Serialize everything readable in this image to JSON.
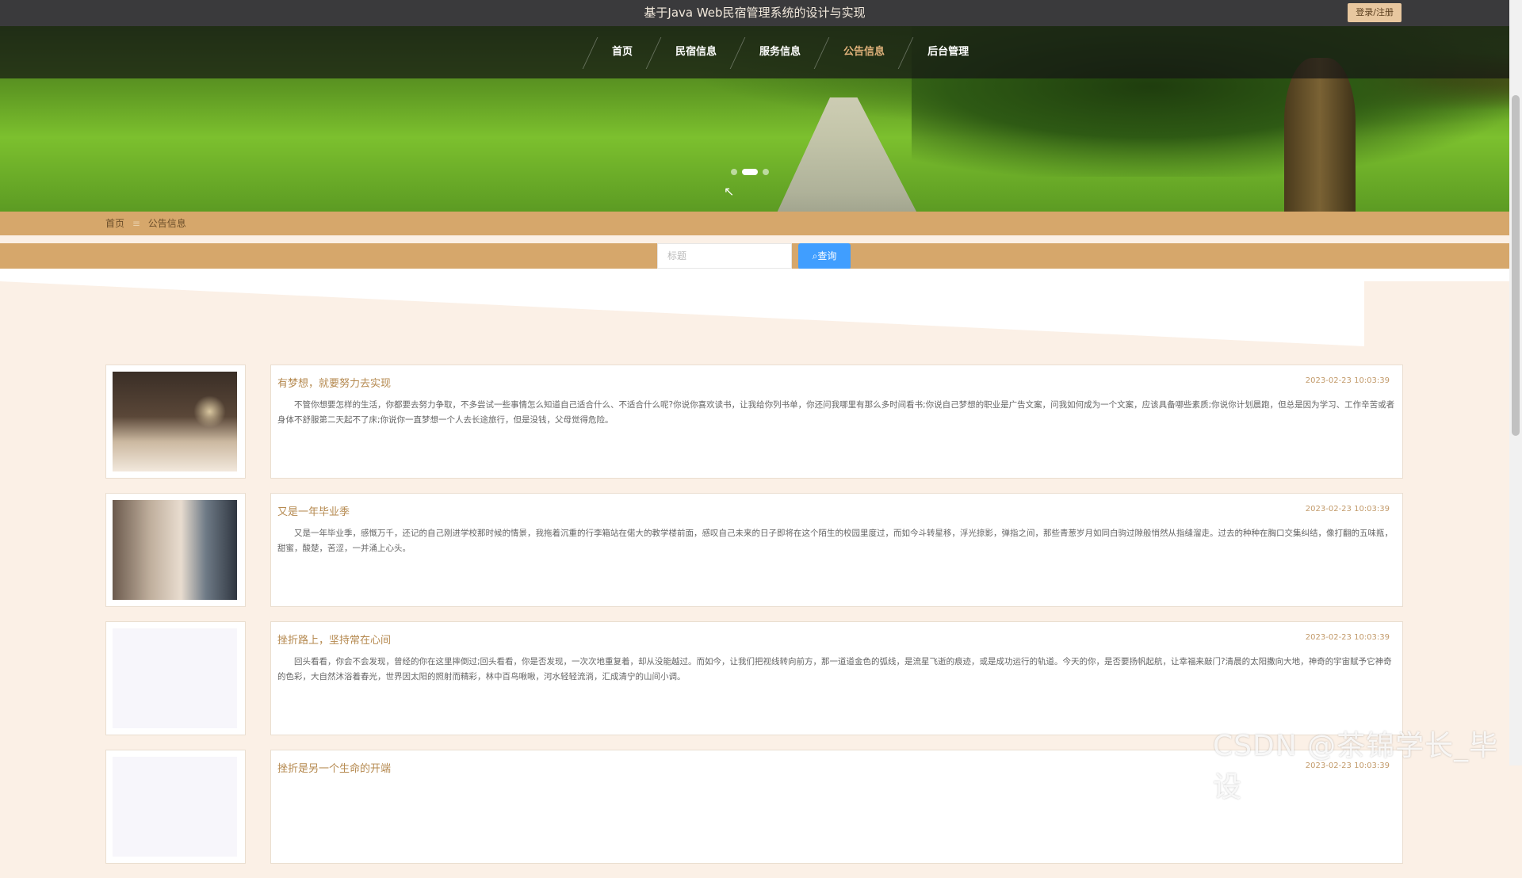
{
  "header": {
    "title": "基于Java Web民宿管理系统的设计与实现",
    "login_label": "登录/注册"
  },
  "nav": {
    "items": [
      {
        "label": "首页"
      },
      {
        "label": "民宿信息"
      },
      {
        "label": "服务信息"
      },
      {
        "label": "公告信息",
        "active": true
      },
      {
        "label": "后台管理"
      }
    ]
  },
  "carousel": {
    "slide_count": 3,
    "active_index": 1
  },
  "breadcrumb": {
    "home": "首页",
    "separator": "≡",
    "current": "公告信息"
  },
  "search": {
    "placeholder": "标题",
    "value": "",
    "button_label": "查询"
  },
  "announcements": [
    {
      "title": "有梦想，就要努力去实现",
      "time": "2023-02-23 10:03:39",
      "desc": "不管你想要怎样的生活，你都要去努力争取，不多尝试一些事情怎么知道自己适合什么、不适合什么呢?你说你喜欢读书，让我给你列书单，你还问我哪里有那么多时间看书;你说自己梦想的职业是广告文案，问我如何成为一个文案，应该具备哪些素质;你说你计划晨跑，但总是因为学习、工作辛苦或者身体不舒服第二天起不了床;你说你一直梦想一个人去长途旅行，但是没钱，父母觉得危险。",
      "image": "room1"
    },
    {
      "title": "又是一年毕业季",
      "time": "2023-02-23 10:03:39",
      "desc": "又是一年毕业季，感慨万千，还记的自己刚进学校那时候的情景，我拖着沉重的行李箱站在偌大的教学楼前面，感叹自己未来的日子即将在这个陌生的校园里度过，而如今斗转星移，浮光掠影，弹指之间，那些青葱岁月如同白驹过隙般悄然从指缝溜走。过去的种种在胸口交集纠结，像打翻的五味瓶，甜蜜，酸楚，苦涩，一并涌上心头。",
      "image": "room2"
    },
    {
      "title": "挫折路上，坚持常在心间",
      "time": "2023-02-23 10:03:39",
      "desc": "回头看看，你会不会发现，曾经的你在这里摔倒过;回头看看，你是否发现，一次次地重复着，却从没能越过。而如今，让我们把视线转向前方，那一道道金色的弧线，是流星飞逝的痕迹，或是成功运行的轨道。今天的你，是否要扬帆起航，让幸福来敲门?清晨的太阳撒向大地，神奇的宇宙赋予它神奇的色彩，大自然沐浴着春光，世界因太阳的照射而精彩，林中百鸟啾啾，河水轻轻流淌，汇成清宁的山间小调。",
      "image": "blank"
    },
    {
      "title": "挫折是另一个生命的开端",
      "time": "2023-02-23 10:03:39",
      "desc": "",
      "image": "blank"
    }
  ],
  "watermark": "CSDN @茶锦学长_毕设"
}
